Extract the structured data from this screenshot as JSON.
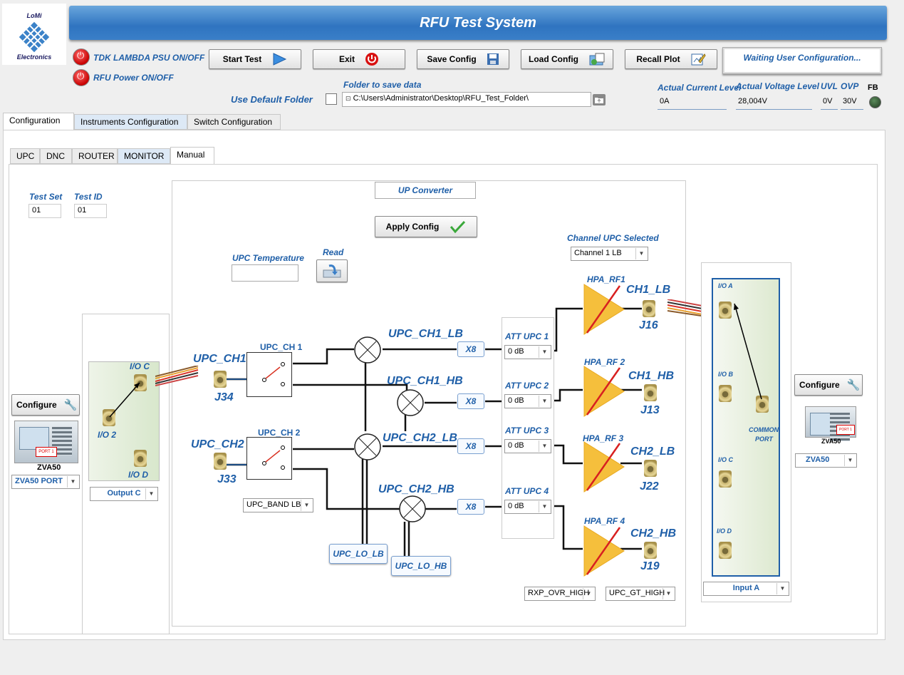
{
  "app": {
    "title": "RFU Test System",
    "logo_top": "LoMi",
    "logo_bottom": "Electronics"
  },
  "power": {
    "psu_label": "TDK LAMBDA PSU ON/OFF",
    "rfu_label": "RFU Power ON/OFF"
  },
  "toolbar": {
    "start": "Start Test",
    "exit": "Exit",
    "save": "Save Config",
    "load": "Load Config",
    "recall": "Recall Plot"
  },
  "status_text": "Waiting User Configuration...",
  "folder": {
    "label": "Folder to save data",
    "default_label": "Use Default Folder",
    "path": "C:\\Users\\Administrator\\Desktop\\RFU_Test_Folder\\"
  },
  "readings": {
    "current_label": "Actual Current Level",
    "voltage_label": "Actual Voltage Level",
    "uvl_label": "UVL",
    "ovp_label": "OVP",
    "fb_label": "FB",
    "current": "0A",
    "voltage": "28,004V",
    "uvl": "0V",
    "ovp": "30V"
  },
  "main_tabs": [
    "Configuration",
    "Instruments Configuration",
    "Switch Configuration"
  ],
  "sub_tabs": [
    "UPC",
    "DNC",
    "ROUTER",
    "MONITOR",
    "Manual"
  ],
  "test": {
    "set_label": "Test Set",
    "id_label": "Test ID",
    "set": "01",
    "id": "01"
  },
  "left_instr": {
    "configure": "Configure",
    "name": "ZVA50",
    "port_select": "ZVA50 PORT",
    "output_select": "Output C",
    "io_c": "I/O C",
    "io_2": "I/O 2",
    "io_d": "I/O D",
    "port_tag": "PORT 1"
  },
  "right_instr": {
    "configure": "Configure",
    "name": "ZVA50",
    "model_select": "ZVA50",
    "input_select": "Input A",
    "io_a": "I/O A",
    "io_b": "I/O B",
    "io_c": "I/O C",
    "io_d": "I/O D",
    "common": "COMMON",
    "port": "PORT",
    "port_tag": "PORT 1"
  },
  "upc": {
    "header": "UP Converter",
    "apply": "Apply Config",
    "temp_label": "UPC Temperature",
    "read_label": "Read",
    "channel_label": "Channel UPC Selected",
    "channel_value": "Channel 1 LB",
    "ch1": "UPC_CH1",
    "ch2": "UPC_CH2",
    "j34": "J34",
    "j33": "J33",
    "sw1": "UPC_CH 1",
    "sw2": "UPC_CH 2",
    "band_select": "UPC_BAND LB",
    "mix_ch1_lb": "UPC_CH1_LB",
    "mix_ch1_hb": "UPC_CH1_HB",
    "mix_ch2_lb": "UPC_CH2_LB",
    "mix_ch2_hb": "UPC_CH2_HB",
    "x8": "X8",
    "lo_lb": "UPC_LO_LB",
    "lo_hb": "UPC_LO_HB",
    "att1": "ATT UPC 1",
    "att2": "ATT UPC 2",
    "att3": "ATT UPC 3",
    "att4": "ATT UPC 4",
    "att_value": "0 dB",
    "hpa1": "HPA_RF1",
    "hpa2": "HPA_RF 2",
    "hpa3": "HPA_RF 3",
    "hpa4": "HPA_RF 4",
    "out_ch1_lb": "CH1_LB",
    "out_ch1_hb": "CH1_HB",
    "out_ch2_lb": "CH2_LB",
    "out_ch2_hb": "CH2_HB",
    "j16": "J16",
    "j13": "J13",
    "j22": "J22",
    "j19": "J19",
    "rxp_select": "RXP_OVR_HIGH",
    "gt_select": "UPC_GT_HIGH"
  }
}
